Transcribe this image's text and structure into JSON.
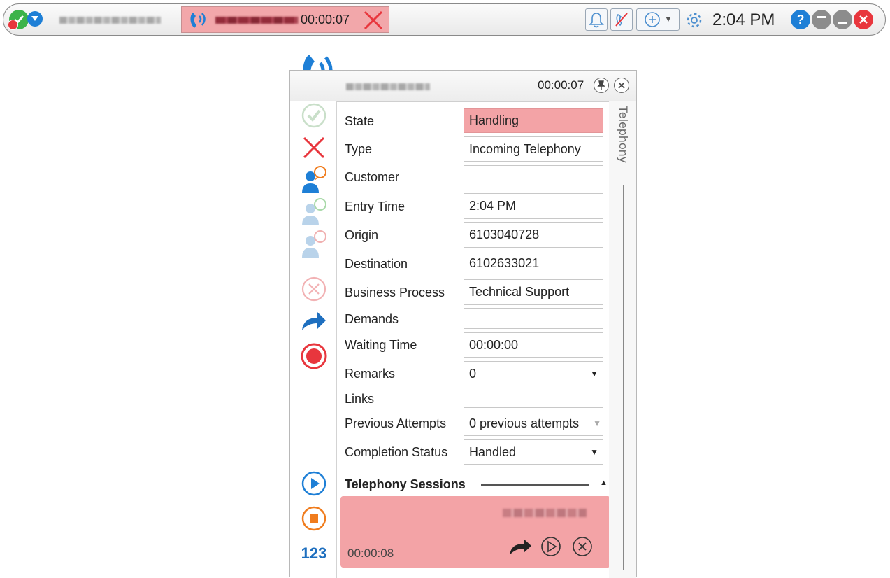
{
  "topbar": {
    "call_timer": "00:00:07",
    "clock": "2:04 PM",
    "icons": [
      "status-ready-icon",
      "dropdown-icon",
      "phone-icon",
      "close-call-icon",
      "bell-icon",
      "mute-icon",
      "add-icon",
      "gear-icon",
      "help-icon",
      "minimize-icon",
      "restore-icon",
      "close-icon"
    ],
    "help_glyph": "?",
    "colors": {
      "active_call": "#f2a7aa",
      "help": "#1e7fd6",
      "close": "#e8363d",
      "ready": "#3cb34a"
    }
  },
  "panel": {
    "timer": "00:00:07",
    "side_tab": "Telephony",
    "left_tools": [
      "accept-icon",
      "hangup-icon",
      "customer-consult-icon",
      "transfer-consult-icon",
      "conference-consult-icon",
      "cancel-icon",
      "forward-icon",
      "record-icon",
      "play-icon",
      "stop-icon",
      "keypad-icon"
    ],
    "keypad_label": "123",
    "fields": [
      {
        "label": "State",
        "value": "Handling"
      },
      {
        "label": "Type",
        "value": "Incoming Telephony"
      },
      {
        "label": "Customer",
        "value": ""
      },
      {
        "label": "Entry Time",
        "value": "2:04 PM"
      },
      {
        "label": "Origin",
        "value": "6103040728"
      },
      {
        "label": "Destination",
        "value": "6102633021"
      },
      {
        "label": "Business Process",
        "value": "Technical Support"
      },
      {
        "label": "Demands",
        "value": ""
      },
      {
        "label": "Waiting Time",
        "value": "00:00:00"
      },
      {
        "label": "Remarks",
        "value": "0"
      },
      {
        "label": "Links",
        "value": ""
      },
      {
        "label": "Previous Attempts",
        "value": "0 previous attempts"
      },
      {
        "label": "Completion Status",
        "value": "Handled"
      }
    ],
    "sessions": {
      "title": "Telephony Sessions",
      "time": "00:00:08"
    },
    "colors": {
      "state": "#f3a3a6",
      "accent_blue": "#1e7fd6",
      "red": "#e8363d",
      "orange": "#f07c1d"
    }
  }
}
